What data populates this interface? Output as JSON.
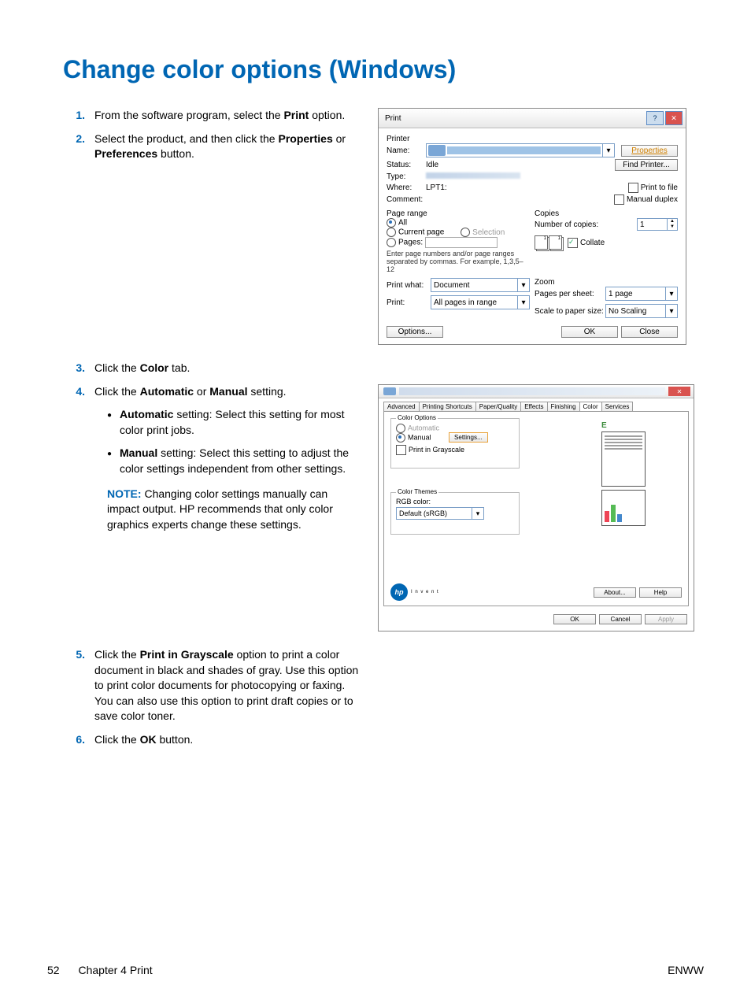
{
  "page_title": "Change color options (Windows)",
  "steps": {
    "s1": {
      "num": "1.",
      "pre": "From the software program, select the ",
      "b1": "Print",
      "post": " option."
    },
    "s2": {
      "num": "2.",
      "pre": "Select the product, and then click the ",
      "b1": "Properties",
      "mid": " or ",
      "b2": "Preferences",
      "post": " button."
    },
    "s3": {
      "num": "3.",
      "pre": "Click the ",
      "b1": "Color",
      "post": " tab."
    },
    "s4": {
      "num": "4.",
      "pre": "Click the ",
      "b1": "Automatic",
      "mid": " or ",
      "b2": "Manual",
      "post": " setting."
    },
    "s5": {
      "num": "5.",
      "pre": "Click the ",
      "b1": "Print in Grayscale",
      "post": " option to print a color document in black and shades of gray. Use this option to print color documents for photocopying or faxing. You can also use this option to print draft copies or to save color toner."
    },
    "s6": {
      "num": "6.",
      "pre": "Click the ",
      "b1": "OK",
      "post": " button."
    }
  },
  "sub_auto": {
    "b": "Automatic",
    "text": " setting: Select this setting for most color print jobs."
  },
  "sub_manual": {
    "b": "Manual",
    "text": " setting: Select this setting to adjust the color settings independent from other settings."
  },
  "note": {
    "label": "NOTE:",
    "text": "Changing color settings manually can impact output. HP recommends that only color graphics experts change these settings."
  },
  "print_dialog": {
    "title": "Print",
    "printer_label": "Printer",
    "name_label": "Name:",
    "status_label": "Status:",
    "status_value": "Idle",
    "type_label": "Type:",
    "where_label": "Where:",
    "where_value": "LPT1:",
    "comment_label": "Comment:",
    "properties_btn": "Properties",
    "find_printer_btn": "Find Printer...",
    "print_to_file": "Print to file",
    "manual_duplex": "Manual duplex",
    "page_range_label": "Page range",
    "all": "All",
    "current_page": "Current page",
    "selection": "Selection",
    "pages": "Pages:",
    "pages_hint": "Enter page numbers and/or page ranges separated by commas. For example, 1,3,5–12",
    "copies_label": "Copies",
    "num_copies": "Number of copies:",
    "num_copies_value": "1",
    "collate": "Collate",
    "print_what_label": "Print what:",
    "print_what_value": "Document",
    "print_label": "Print:",
    "print_value": "All pages in range",
    "zoom_label": "Zoom",
    "pps_label": "Pages per sheet:",
    "pps_value": "1 page",
    "scale_label": "Scale to paper size:",
    "scale_value": "No Scaling",
    "options_btn": "Options...",
    "ok_btn": "OK",
    "close_btn": "Close"
  },
  "color_dialog": {
    "tabs": {
      "advanced": "Advanced",
      "shortcuts": "Printing Shortcuts",
      "paper": "Paper/Quality",
      "effects": "Effects",
      "finishing": "Finishing",
      "color": "Color",
      "services": "Services"
    },
    "color_options_title": "Color Options",
    "automatic": "Automatic",
    "manual": "Manual",
    "settings_btn": "Settings...",
    "grayscale": "Print in Grayscale",
    "color_themes_title": "Color Themes",
    "rgb_label": "RGB color:",
    "rgb_value": "Default (sRGB)",
    "about_btn": "About...",
    "help_btn": "Help",
    "ok_btn": "OK",
    "cancel_btn": "Cancel",
    "apply_btn": "Apply",
    "preview_letter": "E"
  },
  "footer": {
    "page_num": "52",
    "chapter": "Chapter 4   Print",
    "lang": "ENWW"
  }
}
